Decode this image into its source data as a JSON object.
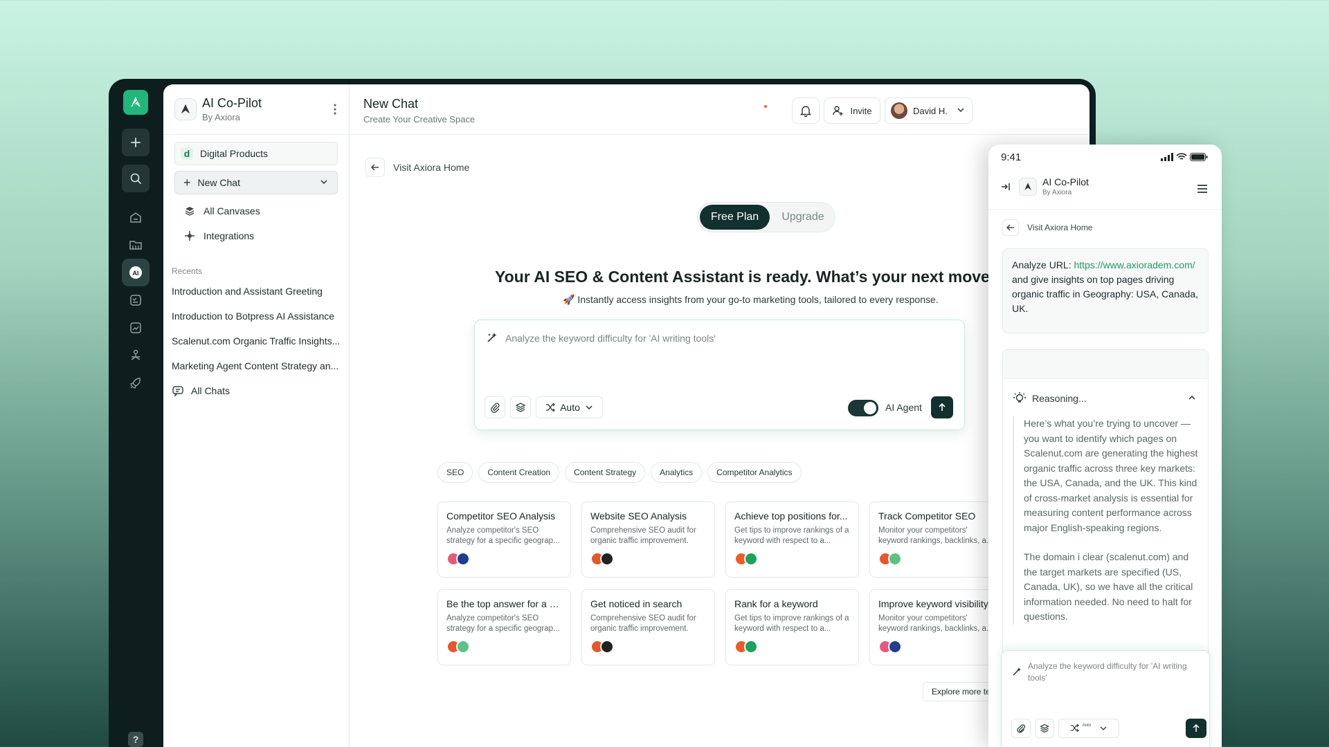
{
  "sidebar": {
    "brand_title": "AI Co-Pilot",
    "brand_sub": "By Axiora",
    "workspace_initial": "d",
    "workspace": "Digital Products",
    "new_chat": "New Chat",
    "nav": [
      {
        "label": "All Canvases",
        "icon": "layers-icon"
      },
      {
        "label": "Integrations",
        "icon": "integrations-icon"
      }
    ],
    "recents_label": "Recents",
    "recents": [
      "Introduction and Assistant Greeting",
      "Introduction to Botpress AI Assistance",
      "Scalenut.com Organic Traffic Insights...",
      "Marketing Agent Content Strategy an..."
    ],
    "all_chats": "All Chats"
  },
  "rail": {
    "help": "?"
  },
  "header": {
    "title": "New Chat",
    "subtitle": "Create Your Creative Space",
    "invite": "Invite",
    "user": "David H."
  },
  "main": {
    "back": "Visit Axiora Home",
    "plan_free": "Free Plan",
    "plan_upgrade": "Upgrade",
    "hero": "Your AI SEO & Content Assistant is ready. What’s your next move?",
    "hero_sub": "🚀 Instantly access insights from your go-to marketing tools, tailored to every response.",
    "prompt_placeholder": "Analyze the keyword difficulty for 'AI writing tools'",
    "mode": "Auto",
    "agent_label": "AI Agent",
    "agent_enabled": true,
    "chips": [
      "SEO",
      "Content Creation",
      "Content Strategy",
      "Analytics",
      "Competitor Analytics"
    ],
    "cards": [
      {
        "title": "Competitor SEO Analysis",
        "desc": "Analyze competitor's SEO strategy for a specific geograp...",
        "icons": [
          "#e9577a",
          "#1f3f8f"
        ]
      },
      {
        "title": "Website SEO Analysis",
        "desc": "Comprehensive SEO audit for organic traffic improvement.",
        "icons": [
          "#e8562a",
          "#222222"
        ]
      },
      {
        "title": "Achieve top positions for...",
        "desc": "Get tips to improve rankings of a keyword with respect to a...",
        "icons": [
          "#f05a28",
          "#1aa260"
        ]
      },
      {
        "title": "Track Competitor SEO",
        "desc": "Monitor your competitors' keyword rankings, backlinks, a...",
        "icons": [
          "#e8562a",
          "#5cc28a"
        ]
      },
      {
        "title": "Be the top answer for a ke...",
        "desc": "Analyze competitor's SEO strategy for a specific geograp...",
        "icons": [
          "#e8562a",
          "#5cc28a"
        ]
      },
      {
        "title": "Get noticed in search",
        "desc": "Comprehensive SEO audit for organic traffic improvement.",
        "icons": [
          "#e8562a",
          "#222222"
        ]
      },
      {
        "title": "Rank for a keyword",
        "desc": "Get tips to improve rankings of a keyword with respect to a...",
        "icons": [
          "#f05a28",
          "#1aa260"
        ]
      },
      {
        "title": "Improve keyword visibility",
        "desc": "Monitor your competitors' keyword rankings, backlinks, a...",
        "icons": [
          "#e9577a",
          "#1f3f8f"
        ]
      }
    ],
    "explore": "Explore more templates"
  },
  "mobile": {
    "time": "9:41",
    "brand_title": "AI Co-Pilot",
    "brand_sub": "By Axiora",
    "back": "Visit Axiora Home",
    "msg_prefix": "Analyze URL: ",
    "msg_link": "https://www.axioradem.com/",
    "msg_rest": " and give insights on top pages driving organic traffic in Geography: USA, Canada, UK.",
    "reasoning": "Reasoning...",
    "reason_p1": "Here’s what you’re trying to uncover — you want to identify which pages on Scalenut.com are generating the highest organic traffic across three key markets: the USA, Canada, and the UK. This kind of cross-market analysis is essential for measuring content performance across major English-speaking regions.",
    "reason_p2": "The domain i clear (scalenut.com) and the target markets are specified (US, Canada, UK), so we have all the critical information needed. No need to halt for questions.",
    "prompt_placeholder": "Analyze the keyword difficulty for 'AI writing tools'",
    "mode": "Auto"
  },
  "colors": {
    "accent": "#11302e",
    "brand": "#23b67a",
    "link": "#1f9a62"
  }
}
